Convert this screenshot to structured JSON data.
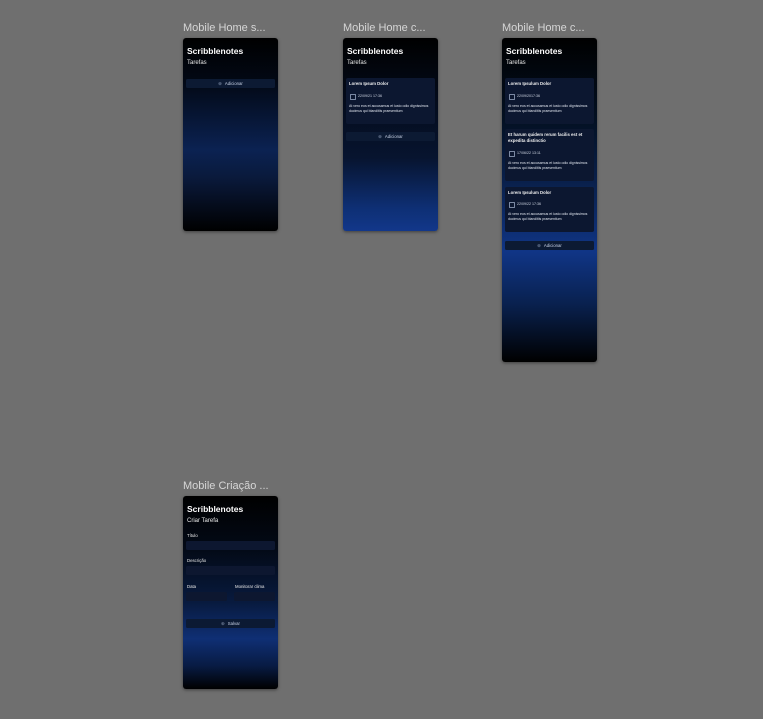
{
  "frames": {
    "empty": {
      "title": "Mobile Home s...",
      "app_title": "Scribblenotes",
      "section": "Tarefas",
      "add_label": "Adicionar"
    },
    "one": {
      "title": "Mobile Home c...",
      "app_title": "Scribblenotes",
      "section": "Tarefas",
      "add_label": "Adicionar",
      "cards": [
        {
          "title": "Lorem Ipsum Dolor",
          "date": "22/09/21 17:36",
          "desc": "At vero eos et accusamus et iusto odio dignissimos ducimus qui blanditiis praesentium"
        }
      ]
    },
    "many": {
      "title": "Mobile Home c...",
      "app_title": "Scribblenotes",
      "section": "Tarefas",
      "add_label": "Adicionar",
      "cards": [
        {
          "title": "Lorem Ipsulum Dolor",
          "date": "22/09/2017:36",
          "desc": "At vero eos et accusamus et iusto odio dignissimos ducimus qui blanditiis praesentium"
        },
        {
          "title": "Et harum quidem rerum facilis est et expedita distinctio",
          "date": "17/06/22 13:11",
          "desc": "At vero eos et accusamus et iusto odio dignissimos ducimus qui blanditiis praesentium"
        },
        {
          "title": "Lorem Ipsulum Dolor",
          "date": "22/09/22 17:36",
          "desc": "At vero eos et accusamus et iusto odio dignissimos ducimus qui blanditiis praesentium"
        }
      ]
    },
    "create": {
      "title": "Mobile Criação ...",
      "app_title": "Scribblenotes",
      "section": "Criar Tarefa",
      "label_title": "Título",
      "label_desc": "Descrição",
      "label_date": "Data",
      "label_weather": "Monitorar clima",
      "save_label": "Salvar"
    }
  },
  "colors": {
    "canvas": "#6f6f6f",
    "accent": "#1a3f8a",
    "surface": "#0c1730"
  },
  "icons": {
    "add": "plus-circle-icon",
    "calendar": "calendar-icon",
    "save": "save-icon"
  }
}
